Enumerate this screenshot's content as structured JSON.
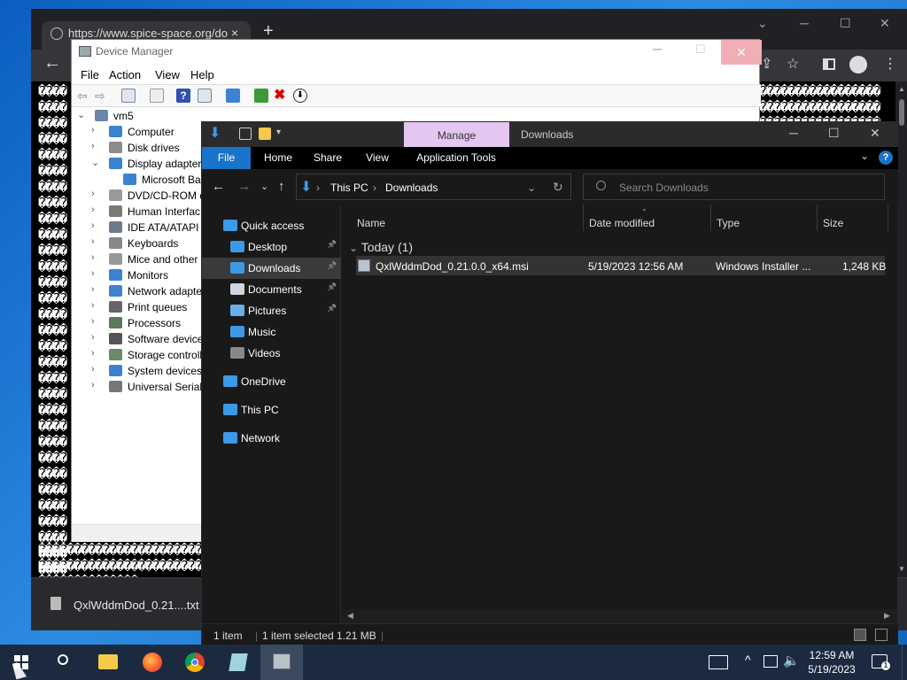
{
  "browser": {
    "tab_url": "https://www.spice-space.org/do",
    "tab_close": "×",
    "new_tab": "+",
    "win_min": "─",
    "win_max": "☐",
    "win_close": "✕",
    "garbled_text": "������������������������������������������������������������������������������������������������������������������������������������������������������������������������������������������������������������������������������������������������������������������������������������������������",
    "garbled_right": "������������������������������������������������������������",
    "download_file": "QxlWddmDod_0.21....txt"
  },
  "device_manager": {
    "title": "Device Manager",
    "menu": [
      "File",
      "Action",
      "View",
      "Help"
    ],
    "tree": [
      {
        "label": "vm5",
        "level": 0,
        "chev": "⌄",
        "icon_color": "#6a86a8"
      },
      {
        "label": "Computer",
        "level": 1,
        "chev": "›",
        "icon_color": "#3b83d1"
      },
      {
        "label": "Disk drives",
        "level": 1,
        "chev": "›",
        "icon_color": "#8b8b8b"
      },
      {
        "label": "Display adapters",
        "level": 1,
        "chev": "⌄",
        "icon_color": "#3b83d1"
      },
      {
        "label": "Microsoft Ba",
        "level": 2,
        "chev": "",
        "icon_color": "#3b83d1"
      },
      {
        "label": "DVD/CD-ROM d",
        "level": 1,
        "chev": "›",
        "icon_color": "#9a9a9a"
      },
      {
        "label": "Human Interfac",
        "level": 1,
        "chev": "›",
        "icon_color": "#7a7a7a"
      },
      {
        "label": "IDE ATA/ATAPI c",
        "level": 1,
        "chev": "›",
        "icon_color": "#6b7b8b"
      },
      {
        "label": "Keyboards",
        "level": 1,
        "chev": "›",
        "icon_color": "#888888"
      },
      {
        "label": "Mice and other",
        "level": 1,
        "chev": "›",
        "icon_color": "#999999"
      },
      {
        "label": "Monitors",
        "level": 1,
        "chev": "›",
        "icon_color": "#3b83d1"
      },
      {
        "label": "Network adapte",
        "level": 1,
        "chev": "›",
        "icon_color": "#3b83d1"
      },
      {
        "label": "Print queues",
        "level": 1,
        "chev": "›",
        "icon_color": "#666666"
      },
      {
        "label": "Processors",
        "level": 1,
        "chev": "›",
        "icon_color": "#5a7a5a"
      },
      {
        "label": "Software device",
        "level": 1,
        "chev": "›",
        "icon_color": "#555555"
      },
      {
        "label": "Storage controll",
        "level": 1,
        "chev": "›",
        "icon_color": "#6a8a6a"
      },
      {
        "label": "System devices",
        "level": 1,
        "chev": "›",
        "icon_color": "#3b83d1"
      },
      {
        "label": "Universal Serial",
        "level": 1,
        "chev": "›",
        "icon_color": "#777777"
      }
    ],
    "min": "─",
    "max": "☐",
    "close": "✕"
  },
  "explorer": {
    "manage_tab": "Manage",
    "title": "Downloads",
    "ribbon_tabs": [
      "File",
      "Home",
      "Share",
      "View",
      "Application Tools"
    ],
    "help": "?",
    "min": "─",
    "max": "☐",
    "close": "✕",
    "nav": {
      "back": "←",
      "forward": "→",
      "recent": "⌄",
      "up": "↑",
      "refresh": "↻",
      "dropdown": "⌄"
    },
    "breadcrumb": [
      "This PC",
      "Downloads"
    ],
    "breadcrumb_sep": "›",
    "search_placeholder": "Search Downloads",
    "nav_pane": [
      {
        "label": "Quick access",
        "indent": 0,
        "pinned": false,
        "selected": false,
        "icon_color": "#3b9ae8"
      },
      {
        "label": "Desktop",
        "indent": 1,
        "pinned": true,
        "selected": false,
        "icon_color": "#3b9ae8"
      },
      {
        "label": "Downloads",
        "indent": 1,
        "pinned": true,
        "selected": true,
        "icon_color": "#3b9ae8"
      },
      {
        "label": "Documents",
        "indent": 1,
        "pinned": true,
        "selected": false,
        "icon_color": "#cfd6e0"
      },
      {
        "label": "Pictures",
        "indent": 1,
        "pinned": true,
        "selected": false,
        "icon_color": "#6ab0e8"
      },
      {
        "label": "Music",
        "indent": 1,
        "pinned": false,
        "selected": false,
        "icon_color": "#3b9ae8"
      },
      {
        "label": "Videos",
        "indent": 1,
        "pinned": false,
        "selected": false,
        "icon_color": "#888888"
      },
      {
        "label": "OneDrive",
        "indent": 0,
        "pinned": false,
        "selected": false,
        "icon_color": "#3b9ae8"
      },
      {
        "label": "This PC",
        "indent": 0,
        "pinned": false,
        "selected": false,
        "icon_color": "#3b9ae8"
      },
      {
        "label": "Network",
        "indent": 0,
        "pinned": false,
        "selected": false,
        "icon_color": "#3b9ae8"
      }
    ],
    "columns": [
      "Name",
      "Date modified",
      "Type",
      "Size"
    ],
    "group_header": "Today (1)",
    "group_chevron": "⌄",
    "files": [
      {
        "name": "QxlWddmDod_0.21.0.0_x64.msi",
        "date": "5/19/2023 12:56 AM",
        "type": "Windows Installer ...",
        "size": "1,248 KB"
      }
    ],
    "status": {
      "items": "1 item",
      "selected": "1 item selected  1.21 MB"
    }
  },
  "taskbar": {
    "time": "12:59 AM",
    "date": "5/19/2023",
    "tray_up": "^"
  }
}
